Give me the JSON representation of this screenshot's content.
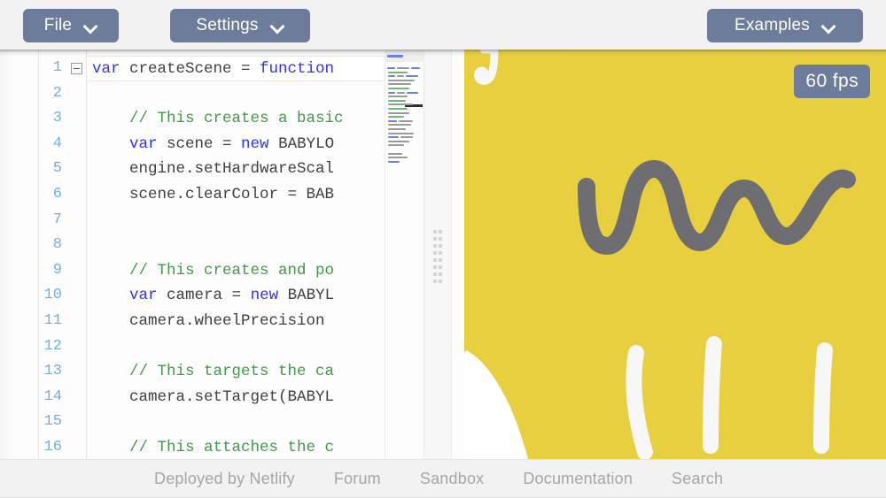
{
  "header": {
    "buttons": [
      {
        "label": "File",
        "icon": "chevron-down-icon"
      },
      {
        "label": "Settings",
        "icon": "chevron-down-icon"
      },
      {
        "label": "Examples",
        "icon": "chevron-down-icon"
      }
    ]
  },
  "editor": {
    "language": "javascript",
    "active_line": 1,
    "line_numbers": [
      "1",
      "2",
      "3",
      "4",
      "5",
      "6",
      "7",
      "8",
      "9",
      "10",
      "11",
      "12",
      "13",
      "14",
      "15",
      "16"
    ],
    "lines": [
      {
        "n": 1,
        "tokens": [
          {
            "t": "var ",
            "c": "kw"
          },
          {
            "t": "createScene = ",
            "c": ""
          },
          {
            "t": "function",
            "c": "kw"
          }
        ]
      },
      {
        "n": 2,
        "tokens": []
      },
      {
        "n": 3,
        "tokens": [
          {
            "t": "    // This creates a basic",
            "c": "cmt"
          }
        ]
      },
      {
        "n": 4,
        "tokens": [
          {
            "t": "    ",
            "c": ""
          },
          {
            "t": "var",
            "c": "kw"
          },
          {
            "t": " scene = ",
            "c": ""
          },
          {
            "t": "new",
            "c": "kw"
          },
          {
            "t": " BABYLO",
            "c": ""
          }
        ]
      },
      {
        "n": 5,
        "tokens": [
          {
            "t": "    engine.setHardwareScal",
            "c": ""
          }
        ]
      },
      {
        "n": 6,
        "tokens": [
          {
            "t": "    scene.clearColor = BAB",
            "c": ""
          }
        ]
      },
      {
        "n": 7,
        "tokens": []
      },
      {
        "n": 8,
        "tokens": []
      },
      {
        "n": 9,
        "tokens": [
          {
            "t": "    // This creates and po",
            "c": "cmt"
          }
        ]
      },
      {
        "n": 10,
        "tokens": [
          {
            "t": "    ",
            "c": ""
          },
          {
            "t": "var",
            "c": "kw"
          },
          {
            "t": " camera = ",
            "c": ""
          },
          {
            "t": "new",
            "c": "kw"
          },
          {
            "t": " BABYL",
            "c": ""
          }
        ]
      },
      {
        "n": 11,
        "tokens": [
          {
            "t": "    camera.wheelPrecision ",
            "c": ""
          }
        ]
      },
      {
        "n": 12,
        "tokens": []
      },
      {
        "n": 13,
        "tokens": [
          {
            "t": "    // This targets the ca",
            "c": "cmt"
          }
        ]
      },
      {
        "n": 14,
        "tokens": [
          {
            "t": "    camera.setTarget(BABYL",
            "c": ""
          }
        ]
      },
      {
        "n": 15,
        "tokens": []
      },
      {
        "n": 16,
        "tokens": [
          {
            "t": "    // This attaches the c",
            "c": "cmt"
          }
        ]
      }
    ],
    "fold_markers": [
      1
    ],
    "minimap": {
      "visible": true,
      "selection_visible": true
    }
  },
  "splitter": {
    "grip": "drag-handle-dots",
    "orientation": "vertical"
  },
  "canvas": {
    "clear_color": "#e8cf3f",
    "fps_label": "60 fps",
    "strokes": [
      {
        "name": "gray-squiggle",
        "color": "#6e6e72"
      },
      {
        "name": "white-arc-left",
        "color": "#ffffff"
      },
      {
        "name": "white-bar-1",
        "color": "#f6f6f6"
      },
      {
        "name": "white-bar-2",
        "color": "#f6f6f6"
      },
      {
        "name": "white-bar-3",
        "color": "#f6f6f6"
      },
      {
        "name": "white-hook-top",
        "color": "#f6f6f6"
      }
    ]
  },
  "footer": {
    "links": [
      "Deployed by Netlify",
      "Forum",
      "Sandbox",
      "Documentation",
      "Search"
    ]
  },
  "colors": {
    "accent": "#6d7c9b",
    "canvas_yellow": "#e8cf3f",
    "keyword": "#3333ee",
    "comment": "#3f9a46",
    "line_number": "#73b0d8",
    "footer_text": "#a6a6a6"
  }
}
